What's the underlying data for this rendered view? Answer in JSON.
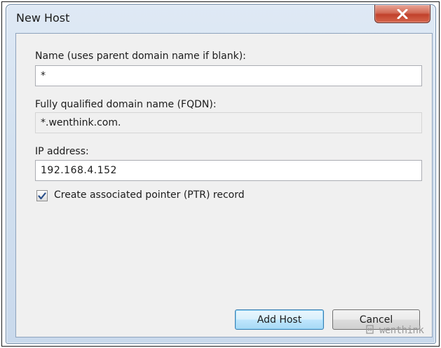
{
  "dialog": {
    "title": "New Host"
  },
  "name_field": {
    "label": "Name (uses parent domain name if blank):",
    "value": "*"
  },
  "fqdn_field": {
    "label": "Fully qualified domain name (FQDN):",
    "value": "*.wenthink.com."
  },
  "ip_field": {
    "label": "IP address:",
    "value": "192.168.4.152"
  },
  "ptr_checkbox": {
    "label": "Create associated pointer (PTR) record",
    "checked": true
  },
  "buttons": {
    "add_host": "Add Host",
    "cancel": "Cancel"
  },
  "watermark": {
    "text": "wenthink"
  },
  "icons": {
    "close": "close-icon",
    "check": "check-icon",
    "watermark_logo": "logo-icon"
  },
  "colors": {
    "close_button": "#c1422c",
    "window_frame": "#d3e1f0",
    "client_area": "#f0f0f0",
    "default_button": "#bee6fd"
  }
}
